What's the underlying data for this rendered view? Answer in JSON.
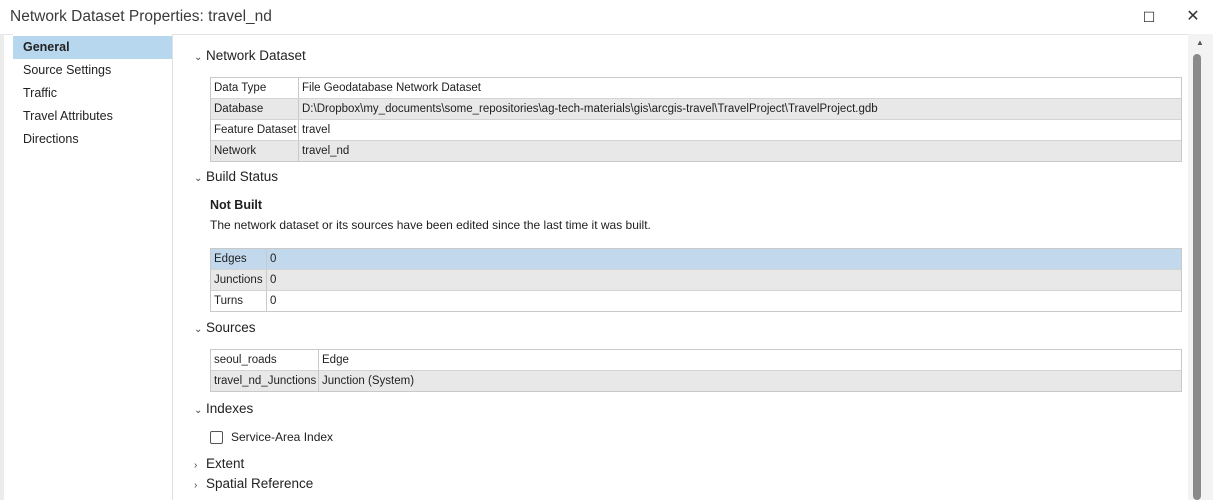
{
  "window": {
    "title": "Network Dataset Properties: travel_nd",
    "maximize_icon": "maximize-icon",
    "close_icon": "close-icon"
  },
  "sidebar": {
    "items": [
      {
        "label": "General",
        "active": true
      },
      {
        "label": "Source Settings"
      },
      {
        "label": "Traffic"
      },
      {
        "label": "Travel Attributes"
      },
      {
        "label": "Directions"
      }
    ]
  },
  "sections": {
    "network_dataset": {
      "title": "Network Dataset",
      "rows": [
        {
          "key": "Data Type",
          "value": "File Geodatabase Network Dataset"
        },
        {
          "key": "Database",
          "value": "D:\\Dropbox\\my_documents\\some_repositories\\ag-tech-materials\\gis\\arcgis-travel\\TravelProject\\TravelProject.gdb"
        },
        {
          "key": "Feature Dataset",
          "value": "travel"
        },
        {
          "key": "Network",
          "value": "travel_nd"
        }
      ]
    },
    "build_status": {
      "title": "Build Status",
      "status": "Not Built",
      "description": "The network dataset or its sources have been edited since the last time it was built.",
      "rows": [
        {
          "key": "Edges",
          "value": "0"
        },
        {
          "key": "Junctions",
          "value": "0"
        },
        {
          "key": "Turns",
          "value": "0"
        }
      ]
    },
    "sources": {
      "title": "Sources",
      "rows": [
        {
          "key": "seoul_roads",
          "value": "Edge"
        },
        {
          "key": "travel_nd_Junctions",
          "value": "Junction (System)"
        }
      ]
    },
    "indexes": {
      "title": "Indexes",
      "checkbox_label": "Service-Area Index",
      "checked": false
    },
    "extent": {
      "title": "Extent"
    },
    "spatial_reference": {
      "title": "Spatial Reference"
    }
  },
  "colors": {
    "selected_nav": "#b7d7ee",
    "selected_row": "#c2d8ec",
    "alt_row": "#e8e8e8"
  }
}
